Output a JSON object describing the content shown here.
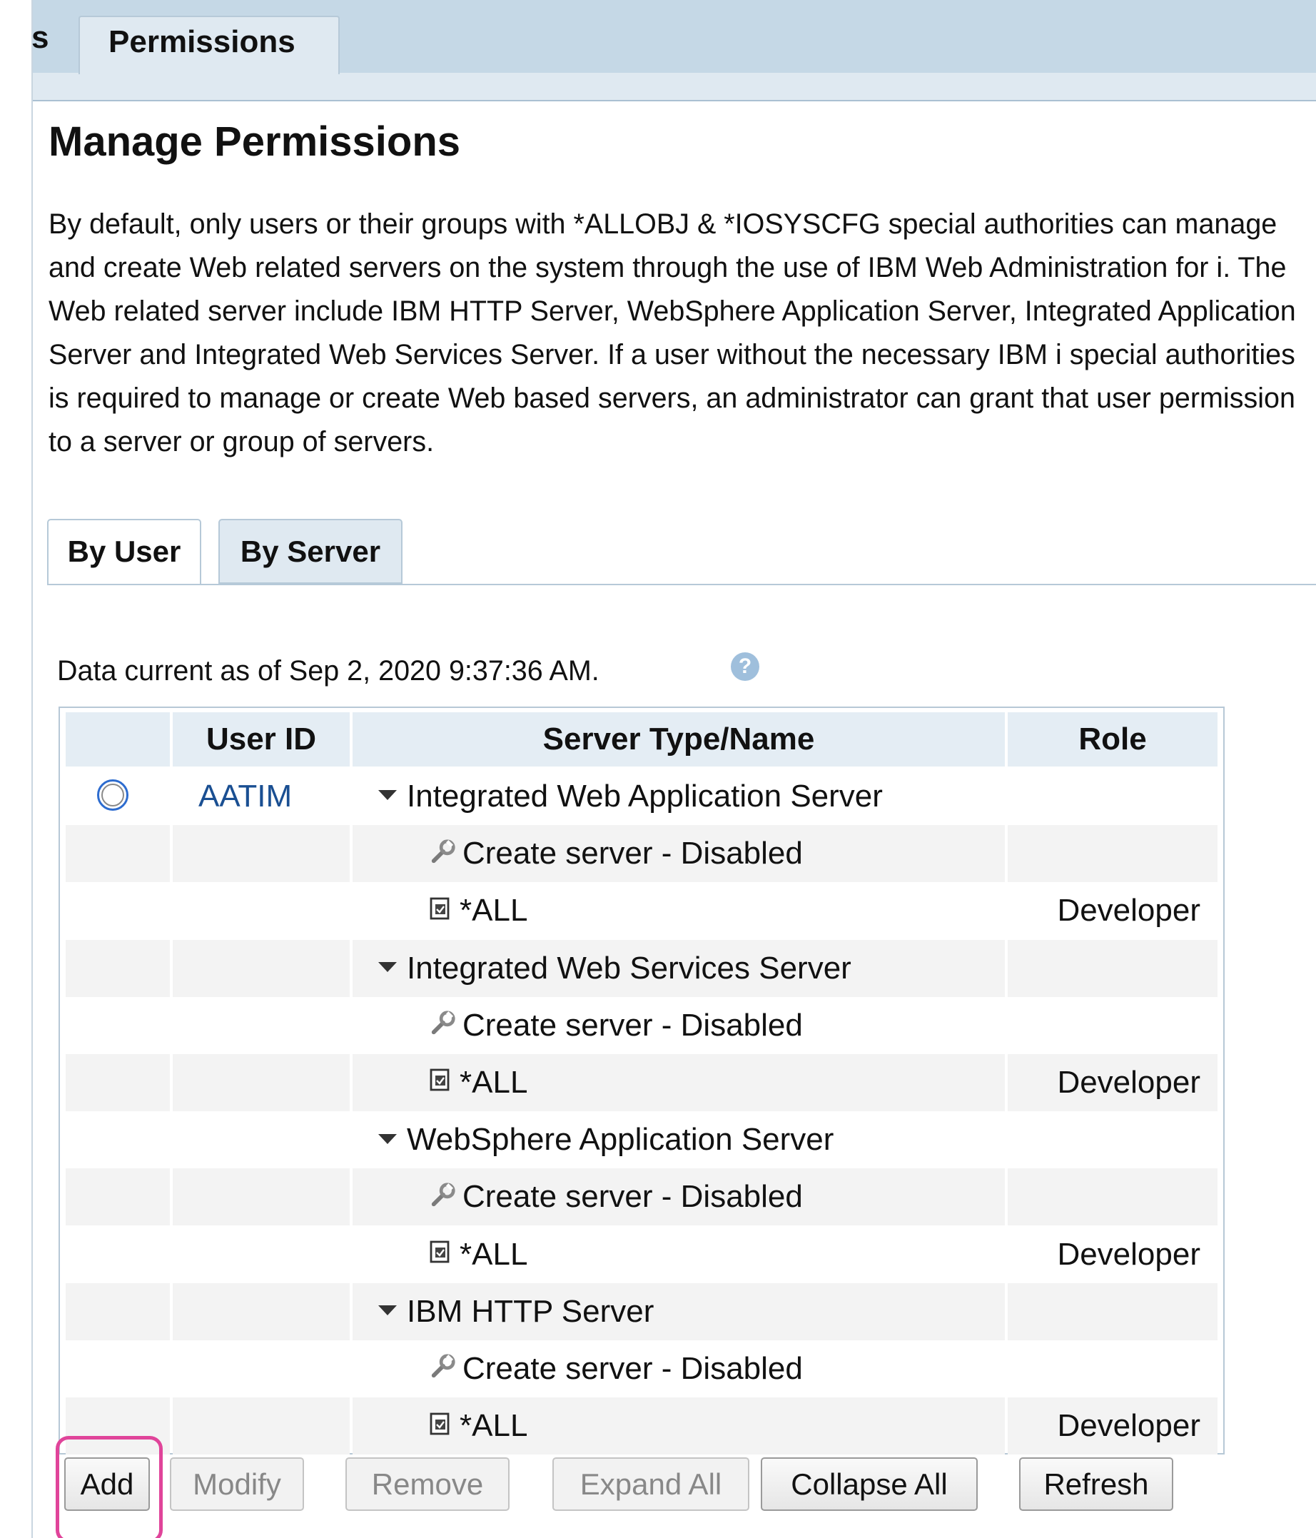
{
  "top_tabs": {
    "partial_tab_label": "s",
    "active_tab_label": "Permissions"
  },
  "page": {
    "title": "Manage Permissions",
    "description": "By default, only users or their groups with *ALLOBJ & *IOSYSCFG special authorities can manage and create Web related servers on the system through the use of IBM Web Administration for i. The Web related server include IBM HTTP Server, WebSphere Application Server, Integrated Application Server and Integrated Web Services Server. If a user without the necessary IBM i special authorities is required to manage or create Web based servers, an administrator can grant that user permission to a server or group of servers."
  },
  "sub_tabs": [
    {
      "label": "By User",
      "active": true
    },
    {
      "label": "By Server",
      "active": false
    }
  ],
  "data_current": "Data current as of Sep 2, 2020 9:37:36 AM.",
  "table": {
    "headers": [
      "",
      "User ID",
      "Server Type/Name",
      "Role"
    ],
    "user_id": "AATIM",
    "rows": [
      {
        "type": "group",
        "label": "Integrated Web Application Server",
        "role": ""
      },
      {
        "type": "create",
        "label": "Create server - Disabled",
        "role": ""
      },
      {
        "type": "all",
        "label": "*ALL",
        "role": "Developer"
      },
      {
        "type": "group",
        "label": "Integrated Web Services Server",
        "role": ""
      },
      {
        "type": "create",
        "label": "Create server - Disabled",
        "role": ""
      },
      {
        "type": "all",
        "label": "*ALL",
        "role": "Developer"
      },
      {
        "type": "group",
        "label": "WebSphere Application Server",
        "role": ""
      },
      {
        "type": "create",
        "label": "Create server - Disabled",
        "role": ""
      },
      {
        "type": "all",
        "label": "*ALL",
        "role": "Developer"
      },
      {
        "type": "group",
        "label": "IBM HTTP Server",
        "role": ""
      },
      {
        "type": "create",
        "label": "Create server - Disabled",
        "role": ""
      },
      {
        "type": "all",
        "label": "*ALL",
        "role": "Developer"
      }
    ]
  },
  "buttons": {
    "add": "Add",
    "modify": "Modify",
    "remove": "Remove",
    "expand_all": "Expand All",
    "collapse_all": "Collapse All",
    "refresh": "Refresh"
  },
  "colors": {
    "link": "#1a4f92",
    "tab_bg": "#dfe9f1",
    "highlight": "#e0449a",
    "radio_focus": "#2d6ccf"
  },
  "icons": {
    "group_toggle": "caret-down-icon",
    "create": "wrench-icon",
    "all": "document-icon",
    "help": "help-icon"
  }
}
